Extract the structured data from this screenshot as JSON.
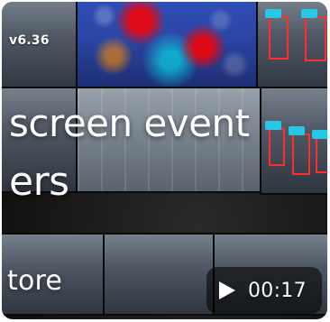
{
  "video": {
    "version_text": "v6.36",
    "title_line1": "screen event",
    "title_line2": "ers",
    "store_text": "tore",
    "duration": "00:17"
  },
  "icons": {
    "play": "play-icon"
  },
  "colors": {
    "overlay_text": "#ffffff",
    "badge_bg": "rgba(0,0,0,0.55)",
    "bbox_red": "#ff2d2d",
    "tag_cyan": "#28c7e8"
  }
}
